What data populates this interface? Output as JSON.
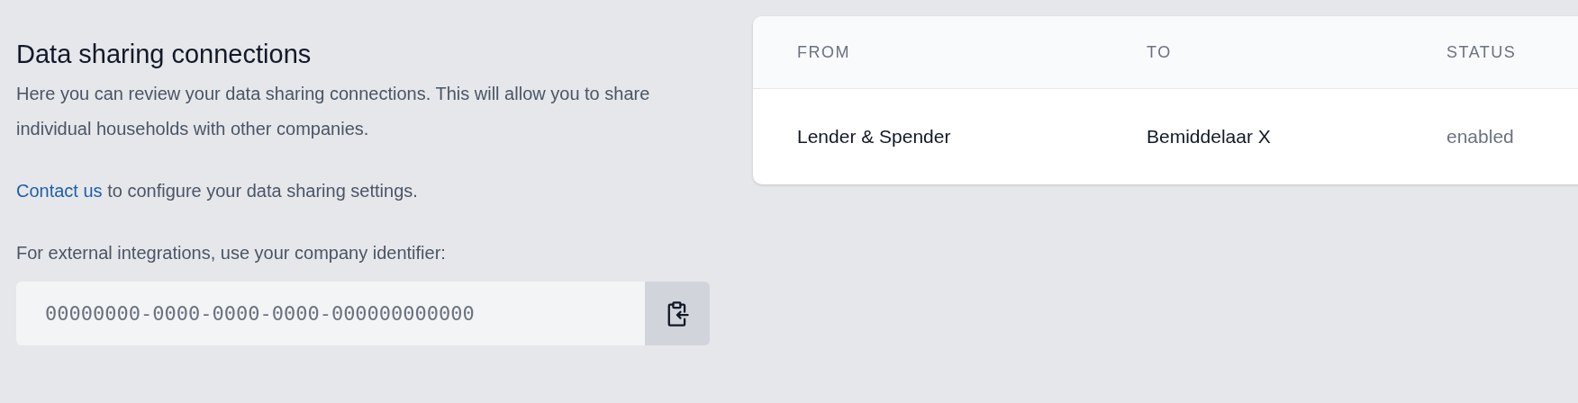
{
  "intro": {
    "title": "Data sharing connections",
    "description": "Here you can review your data sharing connections. This will allow you to share individual households with other companies.",
    "contact_link": "Contact us",
    "contact_text": " to configure your data sharing settings.",
    "identifier_label": "For external integrations, use your company identifier:",
    "identifier_value": "00000000-0000-0000-0000-000000000000"
  },
  "table": {
    "columns": [
      "FROM",
      "TO",
      "STATUS"
    ],
    "rows": [
      {
        "from": "Lender & Spender",
        "to": "Bemiddelaar X",
        "status": "enabled"
      }
    ]
  }
}
